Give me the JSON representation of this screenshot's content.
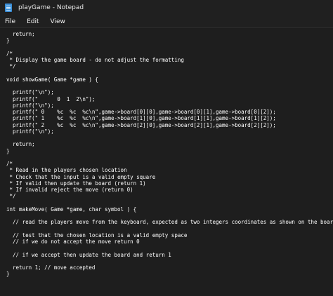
{
  "window": {
    "title": "playGame - Notepad",
    "icon": "notepad-icon"
  },
  "menu": {
    "items": [
      "File",
      "Edit",
      "View"
    ]
  },
  "editor": {
    "content": "  return;\n}\n\n/*\n * Display the game board - do not adjust the formatting\n */\n\nvoid showGame( Game *game ) {\n\n  printf(\"\\n\");\n  printf(\"      0  1  2\\n\");\n  printf(\"\\n\");\n  printf(\" 0    %c  %c  %c\\n\",game->board[0][0],game->board[0][1],game->board[0][2]);\n  printf(\" 1    %c  %c  %c\\n\",game->board[1][0],game->board[1][1],game->board[1][2]);\n  printf(\" 2    %c  %c  %c\\n\",game->board[2][0],game->board[2][1],game->board[2][2]);\n  printf(\"\\n\");\n\n  return;\n}\n\n/*\n * Read in the players chosen location\n * Check that the input is a valid empty square\n * If valid then update the board (return 1)\n * If invalid reject the move (return 0)\n */\n\nint makeMove( Game *game, char symbol ) {\n\n  // read the players move from the keyboard, expected as two integers coordinates as shown on the board\n\n  // test that the chosen location is a valid empty space\n  // if we do not accept the move return 0\n\n  // if we accept then update the board and return 1\n\n  return 1; // move accepted\n}"
  }
}
